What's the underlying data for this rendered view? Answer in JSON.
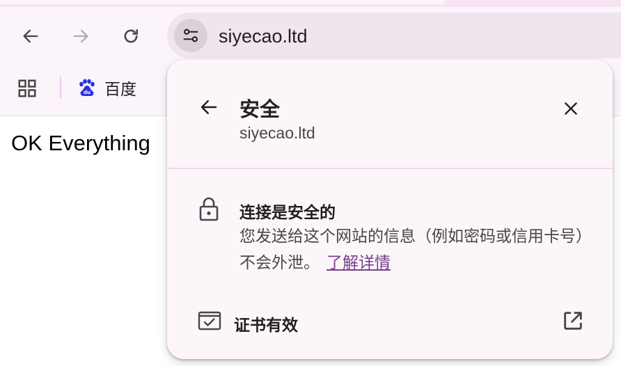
{
  "browser": {
    "address_bar": {
      "url": "siyecao.ltd"
    },
    "bookmarks": [
      {
        "label": "百度",
        "icon": "baidu-paw-icon"
      }
    ]
  },
  "page": {
    "body_text": "OK Everything"
  },
  "security_popup": {
    "title": "安全",
    "domain": "siyecao.ltd",
    "connection": {
      "title": "连接是安全的",
      "description": "您发送给这个网站的信息（例如密码或信用卡号）不会外泄。",
      "learn_more": "了解详情"
    },
    "certificate_label": "证书有效"
  },
  "colors": {
    "toolbar_bg": "#fcf4fb",
    "omnibox_bg": "#f0e4ef",
    "popup_bg": "#fcf6fb",
    "link": "#7a3f8a",
    "baidu_blue": "#2932e1"
  }
}
